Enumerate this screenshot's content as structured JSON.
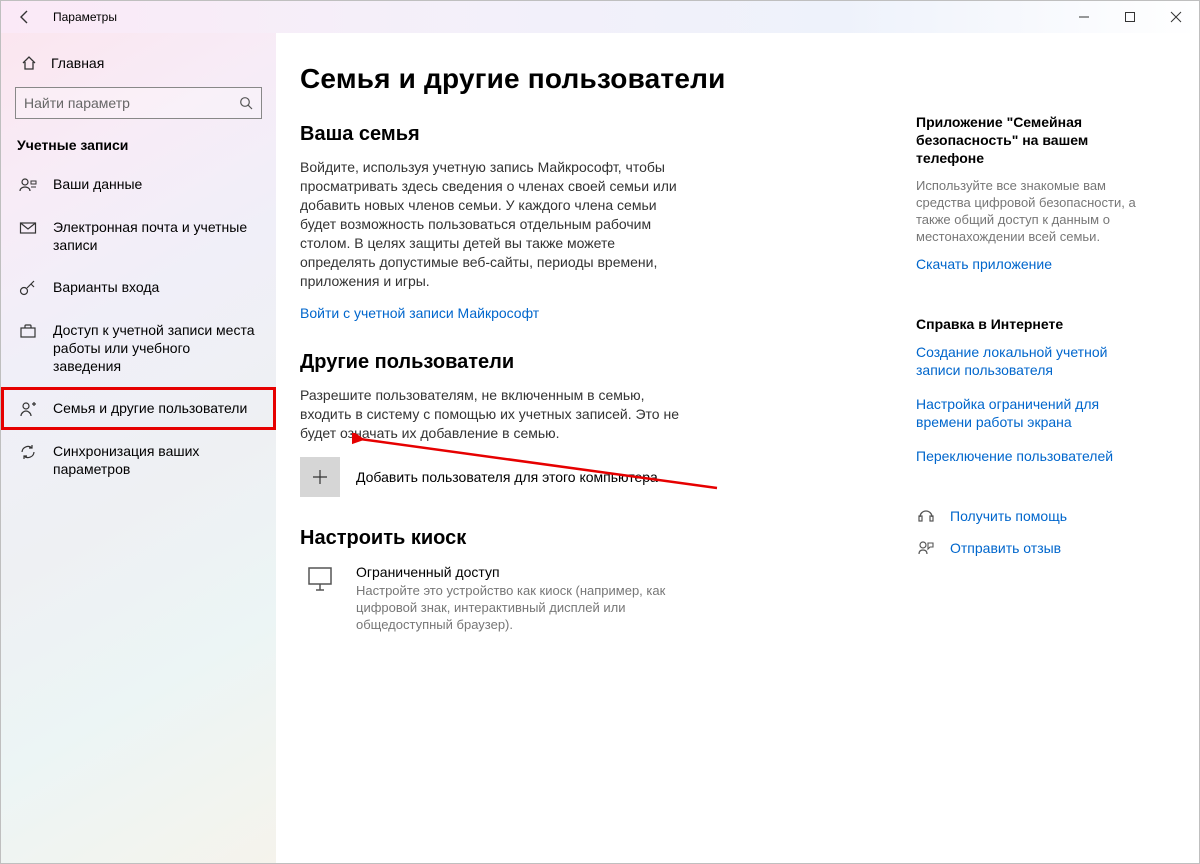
{
  "window": {
    "title": "Параметры"
  },
  "sidebar": {
    "home": "Главная",
    "search_placeholder": "Найти параметр",
    "section": "Учетные записи",
    "items": [
      {
        "label": "Ваши данные"
      },
      {
        "label": "Электронная почта и учетные записи"
      },
      {
        "label": "Варианты входа"
      },
      {
        "label": "Доступ к учетной записи места работы или учебного заведения"
      },
      {
        "label": "Семья и другие пользователи"
      },
      {
        "label": "Синхронизация ваших параметров"
      }
    ]
  },
  "main": {
    "title": "Семья и другие пользователи",
    "family": {
      "heading": "Ваша семья",
      "body": "Войдите, используя учетную запись Майкрософт, чтобы просматривать здесь сведения о членах своей семьи или добавить новых членов семьи. У каждого члена семьи будет возможность пользоваться отдельным рабочим столом. В целях защиты детей вы также можете определять допустимые веб-сайты, периоды времени, приложения и игры.",
      "signin": "Войти с учетной записи Майкрософт"
    },
    "others": {
      "heading": "Другие пользователи",
      "body": "Разрешите пользователям, не включенным в семью, входить в систему с помощью их учетных записей. Это не будет означать их добавление в семью.",
      "add_label": "Добавить пользователя для этого компьютера"
    },
    "kiosk": {
      "heading": "Настроить киоск",
      "title": "Ограниченный доступ",
      "desc": "Настройте это устройство как киоск (например, как цифровой знак, интерактивный дисплей или общедоступный браузер)."
    }
  },
  "right": {
    "promo_title": "Приложение \"Семейная безопасность\" на вашем телефоне",
    "promo_body": "Используйте все знакомые вам средства цифровой безопасности, а также общий доступ к данным о местонахождении всей семьи.",
    "promo_link": "Скачать приложение",
    "help_heading": "Справка в Интернете",
    "help_links": [
      "Создание локальной учетной записи пользователя",
      "Настройка ограничений для времени работы экрана",
      "Переключение пользователей"
    ],
    "get_help": "Получить помощь",
    "feedback": "Отправить отзыв"
  }
}
